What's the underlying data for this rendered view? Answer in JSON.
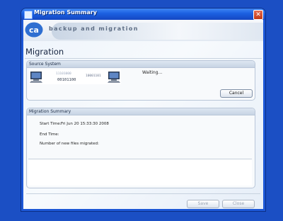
{
  "window": {
    "title": "Migration Summary",
    "close_glyph": "✕"
  },
  "banner": {
    "logo_text": "ca",
    "tagline": "backup and migration"
  },
  "page": {
    "heading": "Migration"
  },
  "source_system": {
    "group_label": "Source System",
    "status_text": "Waiting...",
    "binary_lines": [
      "11101000",
      "10001101",
      "00101100"
    ],
    "cancel_label": "Cancel"
  },
  "summary": {
    "group_label": "Migration Summary",
    "start_time_label": "Start Time:",
    "start_time_value": "Fri Jun 20 15:33:30 2008",
    "end_time_label": "End Time:",
    "end_time_value": "",
    "files_label": "Number of new files migrated:",
    "files_value": ""
  },
  "footer": {
    "save_label": "Save",
    "close_label": "Close"
  },
  "colors": {
    "desktop": "#1b4fc4",
    "titlebar": "#1b5fe0",
    "logo_blue": "#2f6fd1",
    "accent_red": "#d0341b"
  }
}
